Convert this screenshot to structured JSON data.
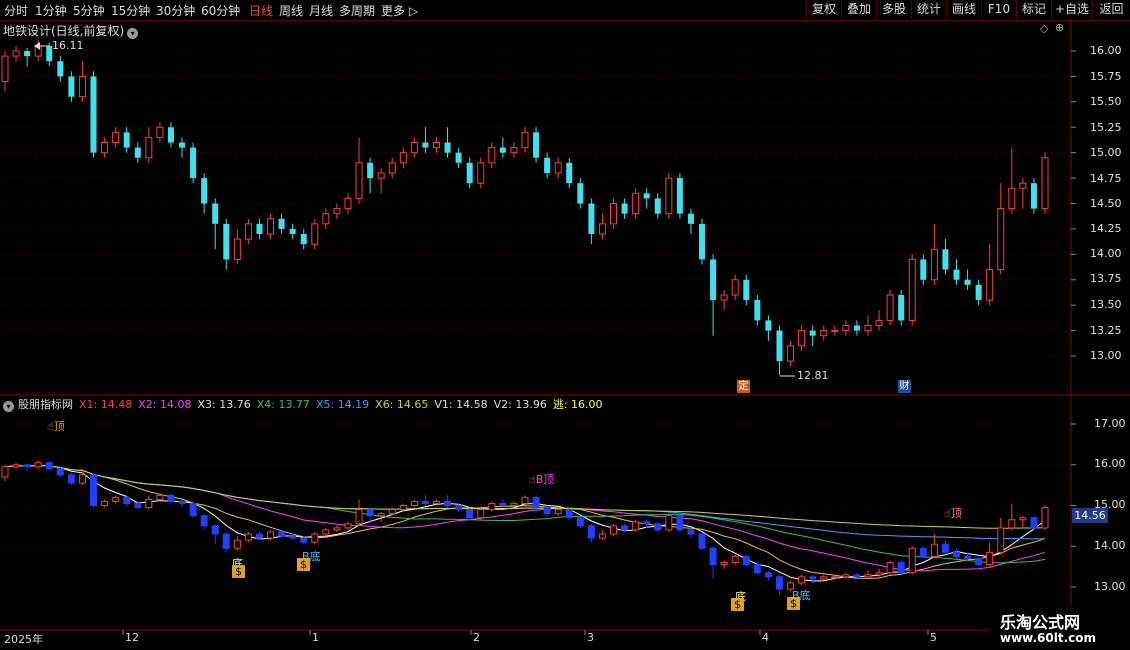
{
  "toolbar": {
    "periods": [
      {
        "label": "分时",
        "active": false
      },
      {
        "label": "1分钟",
        "active": false
      },
      {
        "label": "5分钟",
        "active": false
      },
      {
        "label": "15分钟",
        "active": false
      },
      {
        "label": "30分钟",
        "active": false
      },
      {
        "label": "60分钟",
        "active": false
      },
      {
        "label": "日线",
        "active": true
      },
      {
        "label": "周线",
        "active": false
      },
      {
        "label": "月线",
        "active": false
      },
      {
        "label": "多周期",
        "active": false
      },
      {
        "label": "更多 ▷",
        "active": false
      }
    ],
    "right_buttons": [
      "复权",
      "叠加",
      "多股",
      "统计",
      "画线",
      "F10",
      "标记",
      "+自选",
      "返回"
    ]
  },
  "main_chart": {
    "title": "地铁设计(日线,前复权)",
    "high_label": "16.11",
    "low_label": "12.81",
    "y_ticks": [
      "16.00",
      "15.75",
      "15.50",
      "15.25",
      "15.00",
      "14.75",
      "14.50",
      "14.25",
      "14.00",
      "13.75",
      "13.50",
      "13.25",
      "13.00"
    ],
    "badges": [
      "定",
      "财"
    ]
  },
  "sub_chart": {
    "name": "股朋指标网",
    "values": [
      {
        "label": "X1: 14.48",
        "color": "#ff4040"
      },
      {
        "label": "X2: 14.08",
        "color": "#ff40ff"
      },
      {
        "label": "X3: 13.76",
        "color": "#dddddd"
      },
      {
        "label": "X4: 13.77",
        "color": "#40c040"
      },
      {
        "label": "X5: 14.19",
        "color": "#40a0ff"
      },
      {
        "label": "X6: 14.65",
        "color": "#d0d040"
      },
      {
        "label": "V1: 14.58",
        "color": "#dddddd"
      },
      {
        "label": "V2: 13.96",
        "color": "#dddddd"
      },
      {
        "label": "逃: 16.00",
        "color": "#ffff40"
      }
    ],
    "y_ticks": [
      "17.00",
      "16.00",
      "15.00",
      "14.00",
      "13.00"
    ],
    "current_price": "14.56",
    "signals": [
      {
        "text": "顶",
        "color": "#ff8040"
      },
      {
        "text": "B顶",
        "color": "#ff40ff"
      },
      {
        "text": "底",
        "color": "#ffff80"
      },
      {
        "text": "B底",
        "color": "#40c0ff"
      },
      {
        "text": "底",
        "color": "#ffff80"
      },
      {
        "text": "B底",
        "color": "#40c0ff"
      },
      {
        "text": "顶",
        "color": "#ff8040"
      }
    ]
  },
  "x_axis": [
    "2025年",
    "12",
    "1",
    "2",
    "3",
    "4",
    "5"
  ],
  "watermark": {
    "line1": "乐淘公式网",
    "line2": "www.60lt.com"
  },
  "colors": {
    "up": "#ff3c3c",
    "down": "#40e0f0",
    "sub_down": "#2040ff",
    "grid": "#5a0000"
  },
  "chart_data": {
    "type": "candlestick",
    "ylim": [
      12.8,
      16.2
    ],
    "candles": [
      [
        15.7,
        15.95,
        16.0,
        15.6
      ],
      [
        15.95,
        16.0,
        16.05,
        15.9
      ],
      [
        16.0,
        15.95,
        16.03,
        15.85
      ],
      [
        15.95,
        16.05,
        16.11,
        15.9
      ],
      [
        16.05,
        15.9,
        16.08,
        15.85
      ],
      [
        15.9,
        15.75,
        15.95,
        15.7
      ],
      [
        15.75,
        15.55,
        15.8,
        15.5
      ],
      [
        15.55,
        15.75,
        15.9,
        15.5
      ],
      [
        15.75,
        15.0,
        15.8,
        14.95
      ],
      [
        15.0,
        15.1,
        15.15,
        14.95
      ],
      [
        15.1,
        15.2,
        15.25,
        15.05
      ],
      [
        15.2,
        15.05,
        15.25,
        15.0
      ],
      [
        15.05,
        14.95,
        15.1,
        14.9
      ],
      [
        14.95,
        15.15,
        15.25,
        14.9
      ],
      [
        15.15,
        15.25,
        15.3,
        15.1
      ],
      [
        15.25,
        15.1,
        15.3,
        15.05
      ],
      [
        15.1,
        15.05,
        15.15,
        14.95
      ],
      [
        15.05,
        14.75,
        15.1,
        14.7
      ],
      [
        14.75,
        14.5,
        14.8,
        14.4
      ],
      [
        14.5,
        14.3,
        14.55,
        14.05
      ],
      [
        14.3,
        13.95,
        14.35,
        13.85
      ],
      [
        13.95,
        14.15,
        14.25,
        13.9
      ],
      [
        14.15,
        14.3,
        14.35,
        14.1
      ],
      [
        14.3,
        14.2,
        14.35,
        14.15
      ],
      [
        14.2,
        14.35,
        14.4,
        14.15
      ],
      [
        14.35,
        14.25,
        14.4,
        14.2
      ],
      [
        14.25,
        14.2,
        14.3,
        14.15
      ],
      [
        14.2,
        14.1,
        14.25,
        14.05
      ],
      [
        14.1,
        14.3,
        14.35,
        14.05
      ],
      [
        14.3,
        14.4,
        14.45,
        14.25
      ],
      [
        14.4,
        14.45,
        14.5,
        14.35
      ],
      [
        14.45,
        14.55,
        14.6,
        14.4
      ],
      [
        14.55,
        14.9,
        15.15,
        14.5
      ],
      [
        14.9,
        14.75,
        14.95,
        14.6
      ],
      [
        14.75,
        14.8,
        14.85,
        14.6
      ],
      [
        14.8,
        14.9,
        14.95,
        14.75
      ],
      [
        14.9,
        15.0,
        15.05,
        14.85
      ],
      [
        15.0,
        15.1,
        15.15,
        14.95
      ],
      [
        15.1,
        15.05,
        15.25,
        15.0
      ],
      [
        15.05,
        15.1,
        15.15,
        15.0
      ],
      [
        15.1,
        15.0,
        15.25,
        14.95
      ],
      [
        15.0,
        14.9,
        15.05,
        14.85
      ],
      [
        14.9,
        14.7,
        14.95,
        14.65
      ],
      [
        14.7,
        14.9,
        14.95,
        14.65
      ],
      [
        14.9,
        15.05,
        15.1,
        14.85
      ],
      [
        15.05,
        15.0,
        15.15,
        14.95
      ],
      [
        15.0,
        15.05,
        15.1,
        14.95
      ],
      [
        15.05,
        15.2,
        15.25,
        15.0
      ],
      [
        15.2,
        14.95,
        15.25,
        14.9
      ],
      [
        14.95,
        14.8,
        15.0,
        14.75
      ],
      [
        14.8,
        14.9,
        14.95,
        14.75
      ],
      [
        14.9,
        14.7,
        14.95,
        14.65
      ],
      [
        14.7,
        14.5,
        14.75,
        14.45
      ],
      [
        14.5,
        14.2,
        14.55,
        14.1
      ],
      [
        14.2,
        14.3,
        14.4,
        14.15
      ],
      [
        14.3,
        14.5,
        14.55,
        14.25
      ],
      [
        14.5,
        14.4,
        14.55,
        14.35
      ],
      [
        14.4,
        14.6,
        14.65,
        14.35
      ],
      [
        14.6,
        14.55,
        14.65,
        14.45
      ],
      [
        14.55,
        14.4,
        14.6,
        14.35
      ],
      [
        14.4,
        14.75,
        14.8,
        14.35
      ],
      [
        14.75,
        14.4,
        14.8,
        14.35
      ],
      [
        14.4,
        14.3,
        14.45,
        14.2
      ],
      [
        14.3,
        13.95,
        14.35,
        13.9
      ],
      [
        13.95,
        13.55,
        14.0,
        13.2
      ],
      [
        13.55,
        13.6,
        13.65,
        13.45
      ],
      [
        13.6,
        13.75,
        13.8,
        13.55
      ],
      [
        13.75,
        13.55,
        13.8,
        13.5
      ],
      [
        13.55,
        13.35,
        13.6,
        13.3
      ],
      [
        13.35,
        13.25,
        13.4,
        13.15
      ],
      [
        13.25,
        12.95,
        13.3,
        12.81
      ],
      [
        12.95,
        13.1,
        13.15,
        12.9
      ],
      [
        13.1,
        13.25,
        13.3,
        13.05
      ],
      [
        13.25,
        13.2,
        13.3,
        13.1
      ],
      [
        13.2,
        13.25,
        13.3,
        13.15
      ],
      [
        13.25,
        13.25,
        13.3,
        13.2
      ],
      [
        13.25,
        13.3,
        13.35,
        13.2
      ],
      [
        13.3,
        13.25,
        13.35,
        13.2
      ],
      [
        13.25,
        13.3,
        13.4,
        13.2
      ],
      [
        13.3,
        13.35,
        13.45,
        13.25
      ],
      [
        13.35,
        13.6,
        13.65,
        13.3
      ],
      [
        13.6,
        13.35,
        13.65,
        13.3
      ],
      [
        13.35,
        13.95,
        14.0,
        13.3
      ],
      [
        13.95,
        13.75,
        14.0,
        13.7
      ],
      [
        13.75,
        14.05,
        14.3,
        13.7
      ],
      [
        14.05,
        13.85,
        14.15,
        13.8
      ],
      [
        13.85,
        13.75,
        13.95,
        13.7
      ],
      [
        13.75,
        13.7,
        13.85,
        13.65
      ],
      [
        13.7,
        13.55,
        13.75,
        13.5
      ],
      [
        13.55,
        13.85,
        14.1,
        13.5
      ],
      [
        13.85,
        14.45,
        14.7,
        13.8
      ],
      [
        14.45,
        14.65,
        15.05,
        14.4
      ],
      [
        14.65,
        14.7,
        14.75,
        14.45
      ],
      [
        14.7,
        14.45,
        14.75,
        14.4
      ],
      [
        14.45,
        14.95,
        15.0,
        14.4
      ]
    ],
    "annotations": {
      "max": {
        "value": 16.11
      },
      "min": {
        "value": 12.81
      }
    }
  }
}
